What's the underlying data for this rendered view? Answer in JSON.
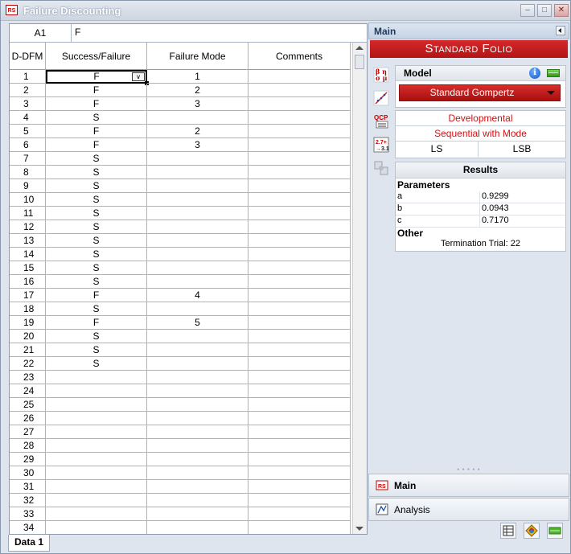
{
  "window": {
    "title": "Failure Discounting"
  },
  "formula_bar": {
    "cell_ref": "A1",
    "value": "F"
  },
  "grid": {
    "columns": [
      "D-DFM",
      "Success/Failure",
      "Failure Mode",
      "Comments"
    ],
    "rows": [
      {
        "n": "1",
        "sf": "F",
        "fm": "1",
        "c": ""
      },
      {
        "n": "2",
        "sf": "F",
        "fm": "2",
        "c": ""
      },
      {
        "n": "3",
        "sf": "F",
        "fm": "3",
        "c": ""
      },
      {
        "n": "4",
        "sf": "S",
        "fm": "",
        "c": ""
      },
      {
        "n": "5",
        "sf": "F",
        "fm": "2",
        "c": ""
      },
      {
        "n": "6",
        "sf": "F",
        "fm": "3",
        "c": ""
      },
      {
        "n": "7",
        "sf": "S",
        "fm": "",
        "c": ""
      },
      {
        "n": "8",
        "sf": "S",
        "fm": "",
        "c": ""
      },
      {
        "n": "9",
        "sf": "S",
        "fm": "",
        "c": ""
      },
      {
        "n": "10",
        "sf": "S",
        "fm": "",
        "c": ""
      },
      {
        "n": "11",
        "sf": "S",
        "fm": "",
        "c": ""
      },
      {
        "n": "12",
        "sf": "S",
        "fm": "",
        "c": ""
      },
      {
        "n": "13",
        "sf": "S",
        "fm": "",
        "c": ""
      },
      {
        "n": "14",
        "sf": "S",
        "fm": "",
        "c": ""
      },
      {
        "n": "15",
        "sf": "S",
        "fm": "",
        "c": ""
      },
      {
        "n": "16",
        "sf": "S",
        "fm": "",
        "c": ""
      },
      {
        "n": "17",
        "sf": "F",
        "fm": "4",
        "c": ""
      },
      {
        "n": "18",
        "sf": "S",
        "fm": "",
        "c": ""
      },
      {
        "n": "19",
        "sf": "F",
        "fm": "5",
        "c": ""
      },
      {
        "n": "20",
        "sf": "S",
        "fm": "",
        "c": ""
      },
      {
        "n": "21",
        "sf": "S",
        "fm": "",
        "c": ""
      },
      {
        "n": "22",
        "sf": "S",
        "fm": "",
        "c": ""
      },
      {
        "n": "23",
        "sf": "",
        "fm": "",
        "c": ""
      },
      {
        "n": "24",
        "sf": "",
        "fm": "",
        "c": ""
      },
      {
        "n": "25",
        "sf": "",
        "fm": "",
        "c": ""
      },
      {
        "n": "26",
        "sf": "",
        "fm": "",
        "c": ""
      },
      {
        "n": "27",
        "sf": "",
        "fm": "",
        "c": ""
      },
      {
        "n": "28",
        "sf": "",
        "fm": "",
        "c": ""
      },
      {
        "n": "29",
        "sf": "",
        "fm": "",
        "c": ""
      },
      {
        "n": "30",
        "sf": "",
        "fm": "",
        "c": ""
      },
      {
        "n": "31",
        "sf": "",
        "fm": "",
        "c": ""
      },
      {
        "n": "32",
        "sf": "",
        "fm": "",
        "c": ""
      },
      {
        "n": "33",
        "sf": "",
        "fm": "",
        "c": ""
      },
      {
        "n": "34",
        "sf": "",
        "fm": "",
        "c": ""
      }
    ]
  },
  "sheet_tabs": [
    "Data 1"
  ],
  "panel": {
    "header": "Main",
    "folio_title": "Standard Folio",
    "model_label": "Model",
    "model_value": "Standard Gompertz",
    "options": [
      "Developmental",
      "Sequential with Mode"
    ],
    "ls_label": "LS",
    "lsb_label": "LSB",
    "results_title": "Results",
    "parameters_label": "Parameters",
    "parameters": [
      {
        "name": "a",
        "value": "0.9299"
      },
      {
        "name": "b",
        "value": "0.0943"
      },
      {
        "name": "c",
        "value": "0.7170"
      }
    ],
    "other_label": "Other",
    "termination": "Termination Trial: 22",
    "nav": [
      {
        "label": "Main",
        "icon": "folio-icon"
      },
      {
        "label": "Analysis",
        "icon": "analysis-icon"
      }
    ]
  },
  "tool_icons": [
    "beta-eta-sigma-mu-icon",
    "plot-icon",
    "qcp-icon",
    "calculator-icon",
    "transfer-icon"
  ],
  "colors": {
    "accent_red": "#c01c1c",
    "option_text": "#d01010",
    "green": "#3aa11b"
  }
}
